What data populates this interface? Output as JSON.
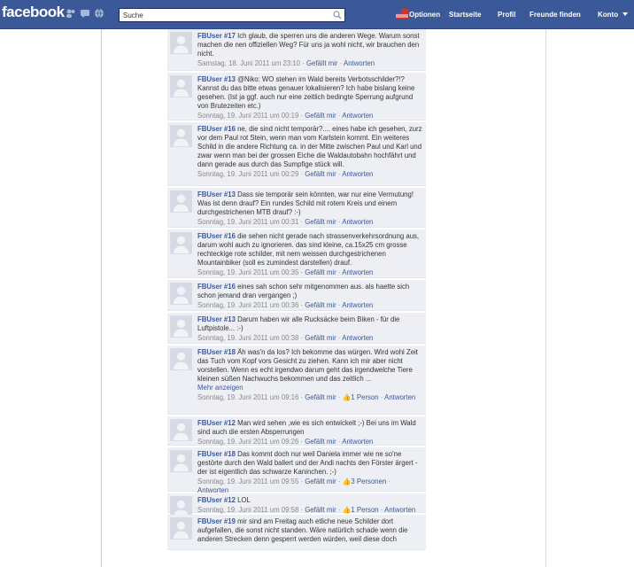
{
  "topbar": {
    "logo": "facebook",
    "search_value": "Suche",
    "options": "Optionen",
    "home": "Startseite",
    "profile": "Profil",
    "find_friends": "Freunde finden",
    "account": "Konto"
  },
  "colors": {
    "brand": "#3b5998",
    "comment_bg": "#edeff4",
    "link": "#3b5998"
  },
  "comments": [
    {
      "user": "FBUser #17",
      "text": "Ich glaub, die sperren uns die anderen Wege. Warum sonst machen die nen offiziellen Weg? Für uns ja wohl nicht, wir brauchen den nicht.",
      "time": "Samstag, 18. Juni 2011 um 23:10",
      "like": "Gefällt mir",
      "reply": "Antworten",
      "likes": ""
    },
    {
      "user": "FBUser #13",
      "text": "@Niko: WO stehen im Wald bereits Verbotsschilder?!? Kannst du das bitte etwas genauer lokalisieren? Ich habe bislang keine gesehen. (Ist ja ggf. auch nur eine zeitlich bedingte Sperrung aufgrund von Brutezeiten etc.)",
      "time": "Sonntag, 19. Juni 2011 um 00:19",
      "like": "Gefällt mir",
      "reply": "Antworten",
      "likes": ""
    },
    {
      "user": "FBUser #16",
      "text": "ne, die sind nicht temporär?.... eines habe ich gesehen, zurz vor dem Paul rot Stein, wenn man vom Karlstein kommt. Ein weiteres Schild in die andere Richtung ca. in der Mitte zwischen Paul und Karl und zwar wenn man bei der grossen Eiche die Waldautobahn hochfährt und dann gerade aus durch das Sumpfige stück will.",
      "time": "Sonntag, 19. Juni 2011 um 00:29",
      "like": "Gefällt mir",
      "reply": "Antworten",
      "likes": ""
    },
    {
      "user": "FBUser #13",
      "text": "Dass sie temporär sein könnten, war nur eine Vermutung! Was ist denn drauf? Ein rundes Schild mit rotem Kreis und einem durchgestrichenen MTB drauf? :-)",
      "time": "Sonntag, 19. Juni 2011 um 00:31",
      "like": "Gefällt mir",
      "reply": "Antworten",
      "likes": ""
    },
    {
      "user": "FBUser #16",
      "text": "die sehen nicht gerade nach strassenverkehrsordnung aus, darum wohl auch zu ignorieren. das sind kleine, ca.15x25 cm grosse rechteckige rote schilder, mit nem weissen durchgestrichenen Mountainbiker (soll es zumindest darstellen) drauf.",
      "time": "Sonntag, 19. Juni 2011 um 00:35",
      "like": "Gefällt mir",
      "reply": "Antworten",
      "likes": ""
    },
    {
      "user": "FBUser #16",
      "text": "eines sah schon sehr mitgenommen aus. als haette sich schon jemand dran vergangen ;)",
      "time": "Sonntag, 19. Juni 2011 um 00:36",
      "like": "Gefällt mir",
      "reply": "Antworten",
      "likes": ""
    },
    {
      "user": "FBUser #13",
      "text": "Darum haben wir alle Rucksäcke beim Biken - für die Luftpistole... :-)",
      "time": "Sonntag, 19. Juni 2011 um 00:38",
      "like": "Gefällt mir",
      "reply": "Antworten",
      "likes": ""
    },
    {
      "user": "FBUser #18",
      "text": "Äh was'n da los? Ich bekomme das würgen. Wird wohl Zeit das Tuch vom Kopf vors Gesicht zu ziehen. Kann ich mir aber nicht vorstellen. Wenn es echt irgendwo darum geht das irgendwelche Tiere kleinen süßen Nachwuchs bekommen und das zeitlich ...",
      "more": "Mehr anzeigen",
      "time": "Sonntag, 19. Juni 2011 um 09:16",
      "like": "Gefällt mir",
      "reply": "Antworten",
      "likes": "1 Person"
    },
    {
      "user": "FBUser #12",
      "text": "Man wird sehen ,wie es sich entwickelt ;-) Bei uns im Wald sind auch die ersten Absperrungen",
      "time": "Sonntag, 19. Juni 2011 um 09:26",
      "like": "Gefällt mir",
      "reply": "Antworten",
      "likes": ""
    },
    {
      "user": "FBUser #18",
      "text": "Das kommt doch nur weil Daniela immer wie ne so'ne gestörte durch den Wald ballert und der Andi nachts den Förster ärgert - der ist eigentlich das schwarze Kaninchen. ;-)",
      "time": "Sonntag, 19. Juni 2011 um 09:55",
      "like": "Gefällt mir",
      "reply": "Antworten",
      "likes": "3 Personen"
    },
    {
      "user": "FBUser #12",
      "text": "LOL",
      "time": "Sonntag, 19. Juni 2011 um 09:58",
      "like": "Gefällt mir",
      "reply": "Antworten",
      "likes": "1 Person"
    },
    {
      "user": "FBUser #19",
      "text": "mir sind am Freitag auch etliche neue Schilder dort aufgefallen, die sonst nicht standen. Wäre natürlich schade wenn die anderen Strecken denn gesperrt werden würden, weil diese doch",
      "time": "",
      "like": "",
      "reply": "",
      "likes": ""
    }
  ]
}
